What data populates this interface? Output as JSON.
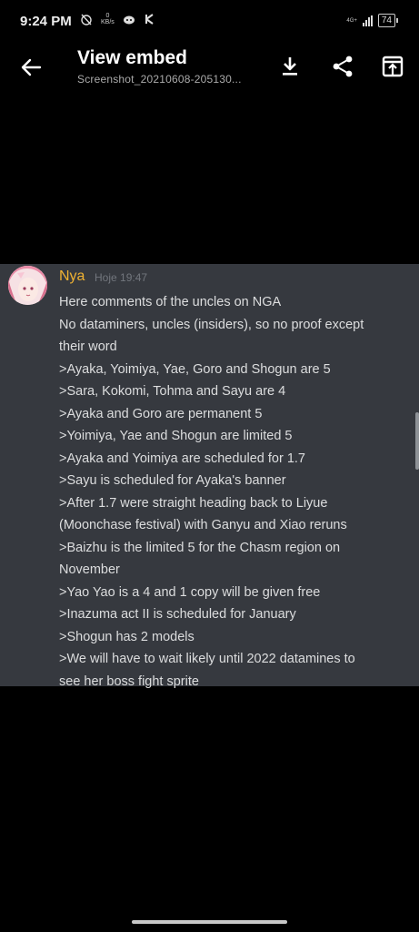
{
  "status_bar": {
    "time": "9:24 PM",
    "net_speed_value": "0",
    "net_speed_unit": "KB/s",
    "network_type": "4G+",
    "battery": "74"
  },
  "app_bar": {
    "title": "View embed",
    "subtitle": "Screenshot_20210608-205130..."
  },
  "message": {
    "author": "Nya",
    "timestamp": "Hoje 19:47",
    "lines": [
      "Here comments of the uncles on NGA",
      "No dataminers, uncles (insiders), so no proof except",
      "their word",
      ">Ayaka, Yoimiya, Yae, Goro and Shogun are 5",
      ">Sara, Kokomi, Tohma and Sayu are 4",
      ">Ayaka and Goro are permanent 5",
      ">Yoimiya, Yae and Shogun are limited 5",
      ">Ayaka and Yoimiya are scheduled for 1.7",
      ">Sayu is scheduled for Ayaka's banner",
      ">After 1.7 were straight heading back to Liyue",
      "(Moonchase festival) with Ganyu and Xiao reruns",
      ">Baizhu is the limited 5 for the Chasm region on",
      "November",
      ">Yao Yao is a 4 and 1 copy will be given free",
      ">Inazuma act II is scheduled for January",
      ">Shogun has 2 models",
      ">We will have to wait likely until 2022 datamines to",
      "see her boss fight sprite"
    ]
  },
  "colors": {
    "author": "#f0b232",
    "panel_bg": "#36393f",
    "message_text": "#dcddde",
    "timestamp": "#72767d"
  }
}
